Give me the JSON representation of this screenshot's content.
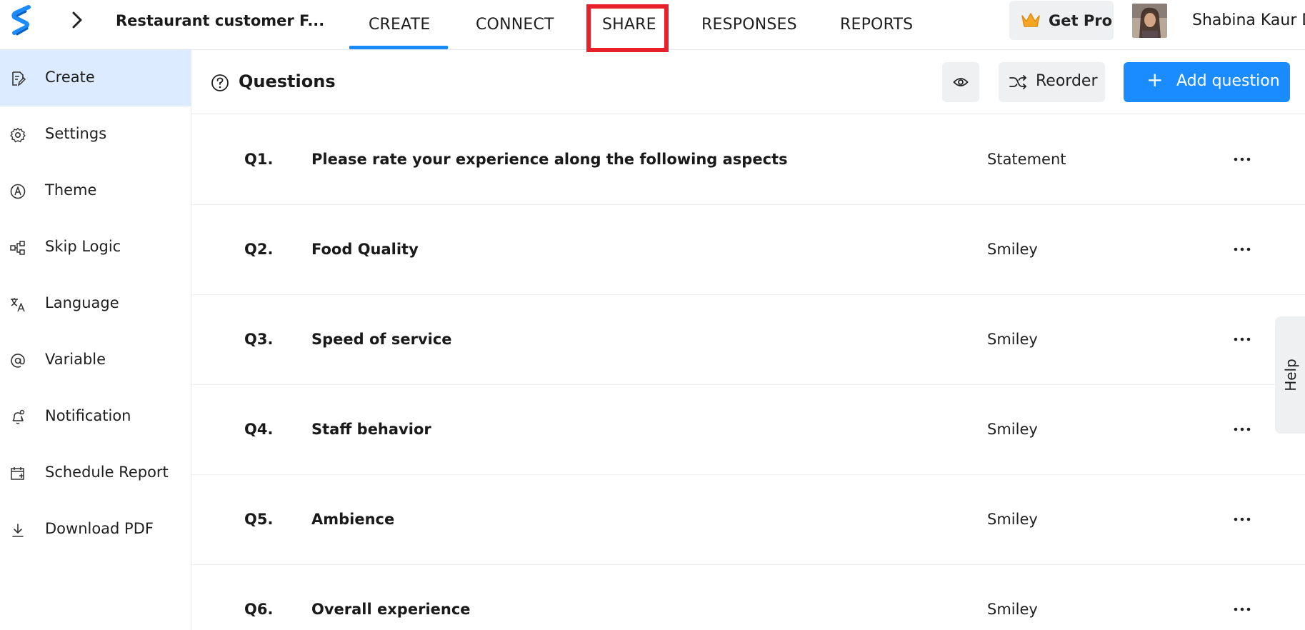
{
  "header": {
    "logo_icon": "brand-s-logo",
    "back_icon": "chevron-right-icon",
    "doc_title": "Restaurant customer F...",
    "tabs": [
      {
        "label": "CREATE",
        "active": true
      },
      {
        "label": "CONNECT",
        "active": false
      },
      {
        "label": "SHARE",
        "active": false,
        "highlighted": true
      },
      {
        "label": "RESPONSES",
        "active": false
      },
      {
        "label": "REPORTS",
        "active": false
      }
    ],
    "get_pro_label": "Get Pro",
    "user_name": "Shabina Kaur D",
    "colors": {
      "accent": "#1a8cff",
      "highlight": "#e8202a",
      "crown": "#f5a623"
    }
  },
  "sidebar": {
    "items": [
      {
        "label": "Create",
        "icon": "edit-document-icon",
        "active": true
      },
      {
        "label": "Settings",
        "icon": "gear-icon",
        "active": false
      },
      {
        "label": "Theme",
        "icon": "theme-icon",
        "active": false
      },
      {
        "label": "Skip Logic",
        "icon": "flow-icon",
        "active": false
      },
      {
        "label": "Language",
        "icon": "translate-icon",
        "active": false
      },
      {
        "label": "Variable",
        "icon": "at-sign-icon",
        "active": false
      },
      {
        "label": "Notification",
        "icon": "bell-icon",
        "active": false
      },
      {
        "label": "Schedule Report",
        "icon": "calendar-icon",
        "active": false
      },
      {
        "label": "Download PDF",
        "icon": "download-icon",
        "active": false
      }
    ]
  },
  "main": {
    "title": "Questions",
    "title_icon": "question-circle-icon",
    "preview_icon": "eye-icon",
    "reorder_label": "Reorder",
    "reorder_icon": "shuffle-icon",
    "add_label": "Add question",
    "add_icon": "plus-icon",
    "questions": [
      {
        "num": "Q1.",
        "text": "Please rate your experience along the following aspects",
        "type": "Statement"
      },
      {
        "num": "Q2.",
        "text": "Food Quality",
        "type": "Smiley"
      },
      {
        "num": "Q3.",
        "text": "Speed of service",
        "type": "Smiley"
      },
      {
        "num": "Q4.",
        "text": "Staff behavior",
        "type": "Smiley"
      },
      {
        "num": "Q5.",
        "text": "Ambience",
        "type": "Smiley"
      },
      {
        "num": "Q6.",
        "text": "Overall experience",
        "type": "Smiley"
      }
    ]
  },
  "help": {
    "label": "Help"
  }
}
